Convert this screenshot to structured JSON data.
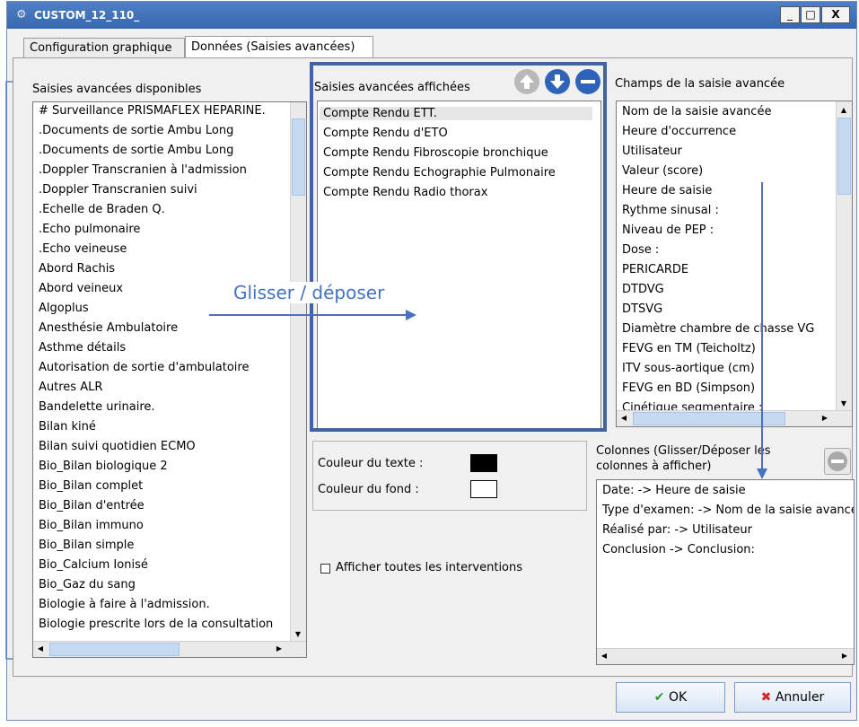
{
  "window": {
    "title": "CUSTOM_12_110_",
    "min_glyph": "_",
    "max_glyph": "□",
    "close_glyph": "X"
  },
  "tabs": [
    {
      "label": "Configuration graphique"
    },
    {
      "label": "Données (Saisies avancées)"
    }
  ],
  "available": {
    "label": "Saisies avancées disponibles",
    "items": [
      "# Surveillance PRISMAFLEX HEPARINE.",
      ".Documents de sortie Ambu Long",
      ".Documents de sortie Ambu Long",
      ".Doppler Transcranien à l'admission",
      ".Doppler Transcranien suivi",
      ".Echelle de Braden Q.",
      ".Echo pulmonaire",
      ".Echo veineuse",
      "Abord Rachis",
      "Abord veineux",
      "Algoplus",
      "Anesthésie Ambulatoire",
      "Asthme détails",
      "Autorisation de sortie d'ambulatoire",
      "Autres ALR",
      "Bandelette urinaire.",
      "Bilan kiné",
      "Bilan suivi quotidien ECMO",
      "Bio_Bilan biologique 2",
      "Bio_Bilan complet",
      "Bio_Bilan d'entrée",
      "Bio_Bilan immuno",
      "Bio_Bilan simple",
      "Bio_Calcium Ionisé",
      "Bio_Gaz du sang",
      "Biologie à faire à l'admission.",
      "Biologie prescrite lors de la consultation"
    ]
  },
  "displayed": {
    "label": "Saisies avancées affichées",
    "items": [
      "Compte Rendu ETT.",
      "Compte Rendu d'ETO",
      "Compte Rendu Fibroscopie bronchique",
      "Compte Rendu Echographie Pulmonaire",
      "Compte Rendu Radio thorax"
    ]
  },
  "fields": {
    "label": "Champs de la saisie avancée",
    "items": [
      "Nom de la saisie avancée",
      "Heure d'occurrence",
      "Utilisateur",
      "Valeur (score)",
      "Heure de saisie",
      "Rythme sinusal :",
      "Niveau de PEP :",
      "Dose  :",
      "PERICARDE",
      "DTDVG",
      "DTSVG",
      "Diamètre chambre de chasse VG",
      "FEVG en TM (Teicholtz)",
      "ITV sous-aortique (cm)",
      "FEVG en BD (Simpson)",
      "Cinétique segmentaire :"
    ]
  },
  "columns": {
    "label_line1": "Colonnes (Glisser/Déposer les",
    "label_line2": "colonnes à afficher)",
    "items": [
      "Date: -> Heure de saisie",
      "Type d'examen: -> Nom de la saisie avancée",
      "Réalisé par: -> Utilisateur",
      "Conclusion -> Conclusion:"
    ]
  },
  "colors": {
    "text_label": "Couleur du texte :",
    "text_color": "#000000",
    "background_label": "Couleur du fond :",
    "background_color": "#ffffff"
  },
  "show_all": {
    "label": "Afficher toutes les interventions",
    "checked": false
  },
  "annotation": {
    "text": "Glisser / déposer",
    "color": "#4472c4"
  },
  "buttons": {
    "ok_label": "OK",
    "cancel_label": "Annuler"
  }
}
